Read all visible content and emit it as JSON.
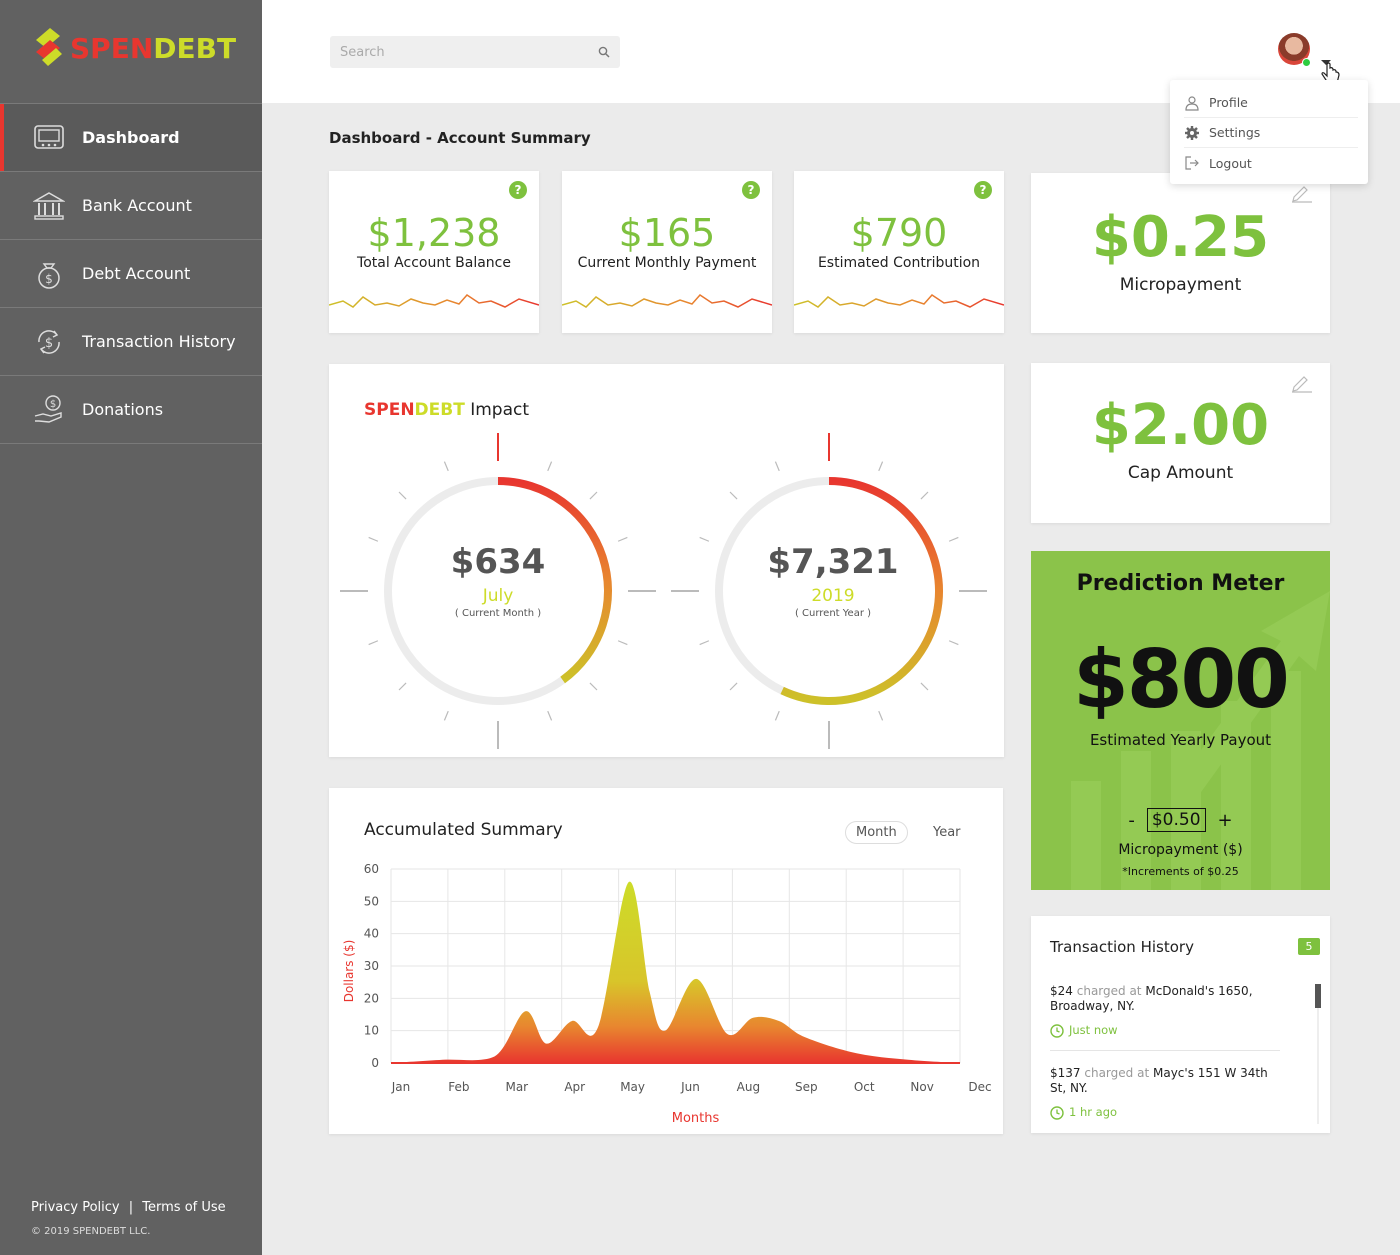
{
  "brand": {
    "part1": "SPEN",
    "part2": "DEBT"
  },
  "colors": {
    "green": "#7ec13e",
    "red": "#e8362f",
    "yellow": "#cddc29",
    "sidebar": "#616161",
    "prediction_bg": "#8bc34a"
  },
  "sidebar": {
    "items": [
      {
        "label": "Dashboard",
        "icon": "monitor-icon",
        "active": true
      },
      {
        "label": "Bank Account",
        "icon": "bank-icon"
      },
      {
        "label": "Debt Account",
        "icon": "money-bag-icon"
      },
      {
        "label": "Transaction History",
        "icon": "dollar-refresh-icon"
      },
      {
        "label": "Donations",
        "icon": "donation-hand-icon"
      }
    ],
    "footer": {
      "privacy": "Privacy Policy",
      "separator": "|",
      "terms": "Terms of Use",
      "copyright": "© 2019 SPENDEBT LLC."
    }
  },
  "header": {
    "search_placeholder": "Search",
    "user_menu": [
      {
        "label": "Profile",
        "icon": "user-icon"
      },
      {
        "label": "Settings",
        "icon": "gear-icon"
      },
      {
        "label": "Logout",
        "icon": "logout-icon"
      }
    ]
  },
  "page_title": "Dashboard - Account Summary",
  "stats": [
    {
      "amount": "$1,238",
      "label": "Total Account Balance"
    },
    {
      "amount": "$165",
      "label": "Current Monthly Payment"
    },
    {
      "amount": "$790",
      "label": "Estimated Contribution"
    }
  ],
  "micropayment": {
    "amount": "$0.25",
    "label": "Micropayment"
  },
  "cap": {
    "amount": "$2.00",
    "label": "Cap Amount"
  },
  "impact": {
    "title_suffix": "Impact",
    "month": {
      "value": "$634",
      "period": "July",
      "sub": "( Current Month )",
      "fraction": 0.4
    },
    "year": {
      "value": "$7,321",
      "period": "2019",
      "sub": "( Current Year )",
      "fraction": 0.57
    }
  },
  "prediction": {
    "title": "Prediction Meter",
    "value": "$800",
    "label": "Estimated Yearly Payout",
    "minus": "-",
    "step_value": "$0.50",
    "plus": "+",
    "micro_label": "Micropayment ($)",
    "increments": "*Increments of $0.25"
  },
  "accumulated": {
    "title": "Accumulated Summary",
    "toggle_month": "Month",
    "toggle_year": "Year"
  },
  "chart_data": {
    "type": "area",
    "title": "Accumulated Summary",
    "xlabel": "Months",
    "ylabel": "Dollars ($)",
    "categories": [
      "Jan",
      "Feb",
      "Mar",
      "Apr",
      "May",
      "Jun",
      "Aug",
      "Sep",
      "Oct",
      "Nov",
      "Dec"
    ],
    "x": [
      0,
      1,
      2,
      2.6,
      3,
      3.5,
      4,
      4.6,
      5,
      5.3,
      5.9,
      6.5,
      7,
      7.5,
      8,
      9,
      10,
      11
    ],
    "y": [
      0,
      1,
      2,
      16,
      6,
      13,
      11,
      56,
      22,
      10,
      26,
      9,
      14,
      13,
      8,
      3,
      1,
      0
    ],
    "yticks": [
      0,
      10,
      20,
      30,
      40,
      50,
      60
    ],
    "ylim": [
      0,
      60
    ],
    "grid": true
  },
  "transactions": {
    "title": "Transaction History",
    "count": "5",
    "items": [
      {
        "amount": "$24",
        "verb": "charged at",
        "place": "McDonald's 1650, Broadway, NY.",
        "time": "Just now"
      },
      {
        "amount": "$137",
        "verb": "charged at",
        "place": "Mayc's 151 W 34th St, NY.",
        "time": "1 hr ago"
      }
    ]
  }
}
